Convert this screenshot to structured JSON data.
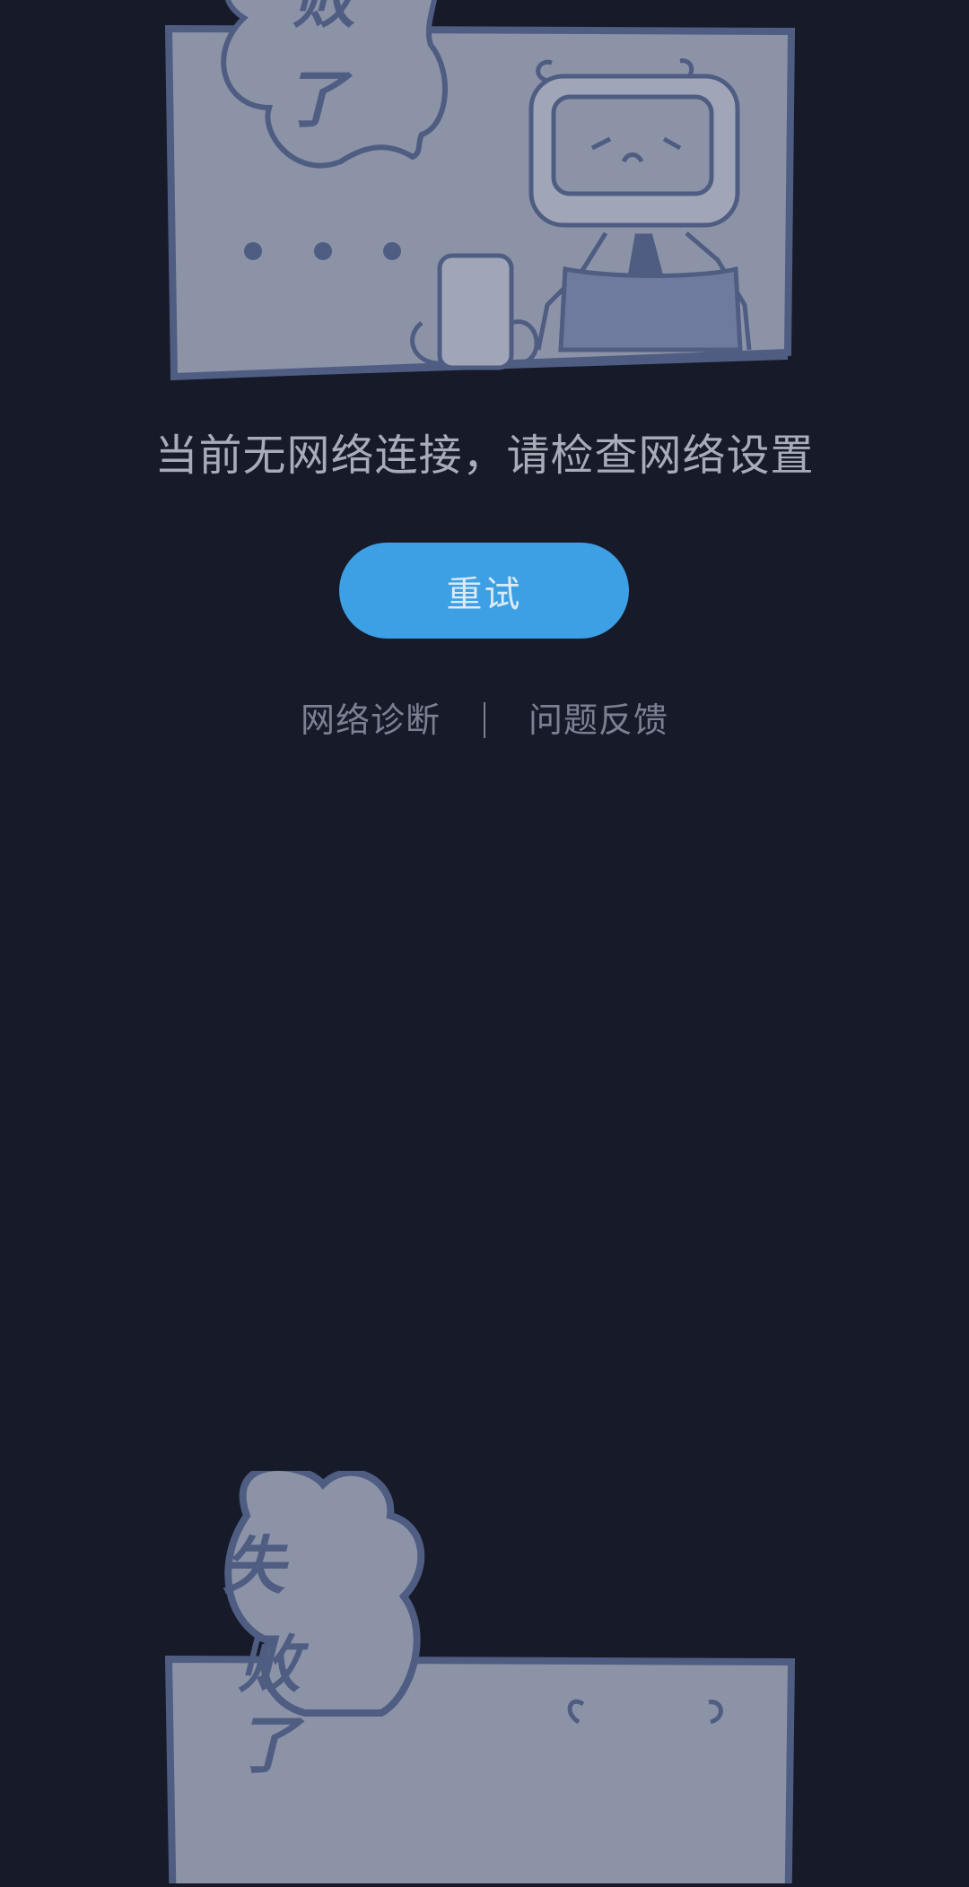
{
  "illustration_top": {
    "bubble_text_1": "败",
    "bubble_text_2": "了"
  },
  "message": "当前无网络连接，请检查网络设置",
  "retry_button": "重试",
  "links": {
    "diagnose": "网络诊断",
    "feedback": "问题反馈"
  },
  "illustration_bottom": {
    "bubble_text_1": "失",
    "bubble_text_2": "败",
    "bubble_text_3": "了"
  },
  "colors": {
    "background": "#161a29",
    "accent": "#3d9fe4",
    "panel": "#8c93a7",
    "outline": "#4f5d82"
  }
}
